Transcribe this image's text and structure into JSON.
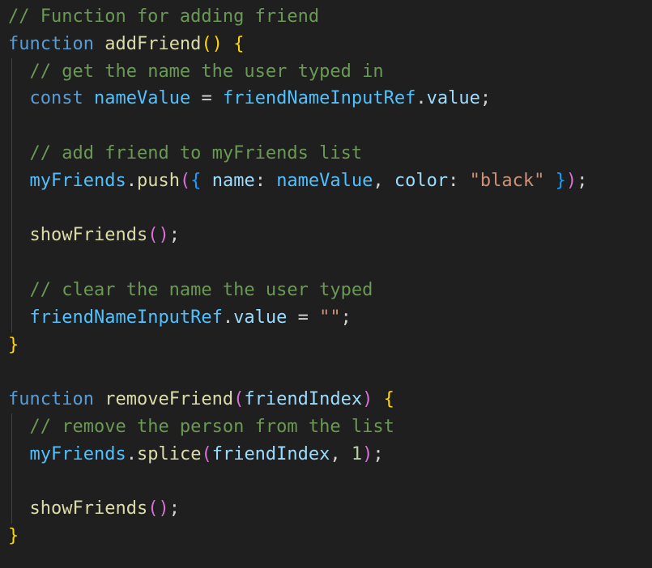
{
  "editor": {
    "colors": {
      "background": "#1f1f1f",
      "comment": "#6a9955",
      "keyword": "#569cd6",
      "function": "#dcdcaa",
      "variable": "#9cdcfe",
      "constant": "#4fc1ff",
      "string": "#ce9178",
      "number": "#b5cea8",
      "bracket_level_1": "#ffd700",
      "bracket_level_2": "#da70d6",
      "bracket_level_3": "#179fff",
      "plain": "#d4d4d4"
    },
    "lines": [
      {
        "indent": 0,
        "tokens": [
          {
            "t": "// Function for adding friend",
            "k": "comment"
          }
        ]
      },
      {
        "indent": 0,
        "tokens": [
          {
            "t": "function",
            "k": "keyword"
          },
          {
            "t": " ",
            "k": "plain"
          },
          {
            "t": "addFriend",
            "k": "function"
          },
          {
            "t": "()",
            "k": "bracket_level_1"
          },
          {
            "t": " ",
            "k": "plain"
          },
          {
            "t": "{",
            "k": "bracket_level_1"
          }
        ]
      },
      {
        "indent": 1,
        "tokens": [
          {
            "t": "// get the name the user typed in",
            "k": "comment"
          }
        ]
      },
      {
        "indent": 1,
        "tokens": [
          {
            "t": "const",
            "k": "keyword"
          },
          {
            "t": " ",
            "k": "plain"
          },
          {
            "t": "nameValue",
            "k": "constant"
          },
          {
            "t": " = ",
            "k": "plain"
          },
          {
            "t": "friendNameInputRef",
            "k": "constant"
          },
          {
            "t": ".",
            "k": "plain"
          },
          {
            "t": "value",
            "k": "variable"
          },
          {
            "t": ";",
            "k": "plain"
          }
        ]
      },
      {
        "indent": 1,
        "tokens": []
      },
      {
        "indent": 1,
        "tokens": [
          {
            "t": "// add friend to myFriends list",
            "k": "comment"
          }
        ]
      },
      {
        "indent": 1,
        "tokens": [
          {
            "t": "myFriends",
            "k": "constant"
          },
          {
            "t": ".",
            "k": "plain"
          },
          {
            "t": "push",
            "k": "function"
          },
          {
            "t": "(",
            "k": "bracket_level_2"
          },
          {
            "t": "{",
            "k": "bracket_level_3"
          },
          {
            "t": " ",
            "k": "plain"
          },
          {
            "t": "name",
            "k": "variable"
          },
          {
            "t": ": ",
            "k": "plain"
          },
          {
            "t": "nameValue",
            "k": "constant"
          },
          {
            "t": ", ",
            "k": "plain"
          },
          {
            "t": "color",
            "k": "variable"
          },
          {
            "t": ": ",
            "k": "plain"
          },
          {
            "t": "\"black\"",
            "k": "string"
          },
          {
            "t": " ",
            "k": "plain"
          },
          {
            "t": "}",
            "k": "bracket_level_3"
          },
          {
            "t": ")",
            "k": "bracket_level_2"
          },
          {
            "t": ";",
            "k": "plain"
          }
        ]
      },
      {
        "indent": 1,
        "tokens": []
      },
      {
        "indent": 1,
        "tokens": [
          {
            "t": "showFriends",
            "k": "function"
          },
          {
            "t": "()",
            "k": "bracket_level_2"
          },
          {
            "t": ";",
            "k": "plain"
          }
        ]
      },
      {
        "indent": 1,
        "tokens": []
      },
      {
        "indent": 1,
        "tokens": [
          {
            "t": "// clear the name the user typed",
            "k": "comment"
          }
        ]
      },
      {
        "indent": 1,
        "tokens": [
          {
            "t": "friendNameInputRef",
            "k": "constant"
          },
          {
            "t": ".",
            "k": "plain"
          },
          {
            "t": "value",
            "k": "variable"
          },
          {
            "t": " = ",
            "k": "plain"
          },
          {
            "t": "\"\"",
            "k": "string"
          },
          {
            "t": ";",
            "k": "plain"
          }
        ]
      },
      {
        "indent": 0,
        "tokens": [
          {
            "t": "}",
            "k": "bracket_level_1"
          }
        ]
      },
      {
        "indent": 0,
        "tokens": []
      },
      {
        "indent": 0,
        "tokens": [
          {
            "t": "function",
            "k": "keyword"
          },
          {
            "t": " ",
            "k": "plain"
          },
          {
            "t": "removeFriend",
            "k": "function"
          },
          {
            "t": "(",
            "k": "bracket_level_2"
          },
          {
            "t": "friendIndex",
            "k": "variable"
          },
          {
            "t": ")",
            "k": "bracket_level_2"
          },
          {
            "t": " ",
            "k": "plain"
          },
          {
            "t": "{",
            "k": "bracket_level_1"
          }
        ]
      },
      {
        "indent": 1,
        "tokens": [
          {
            "t": "// remove the person from the list",
            "k": "comment"
          }
        ]
      },
      {
        "indent": 1,
        "tokens": [
          {
            "t": "myFriends",
            "k": "constant"
          },
          {
            "t": ".",
            "k": "plain"
          },
          {
            "t": "splice",
            "k": "function"
          },
          {
            "t": "(",
            "k": "bracket_level_2"
          },
          {
            "t": "friendIndex",
            "k": "variable"
          },
          {
            "t": ", ",
            "k": "plain"
          },
          {
            "t": "1",
            "k": "number"
          },
          {
            "t": ")",
            "k": "bracket_level_2"
          },
          {
            "t": ";",
            "k": "plain"
          }
        ]
      },
      {
        "indent": 1,
        "tokens": []
      },
      {
        "indent": 1,
        "tokens": [
          {
            "t": "showFriends",
            "k": "function"
          },
          {
            "t": "()",
            "k": "bracket_level_2"
          },
          {
            "t": ";",
            "k": "plain"
          }
        ]
      },
      {
        "indent": 0,
        "tokens": [
          {
            "t": "}",
            "k": "bracket_level_1"
          }
        ]
      }
    ]
  }
}
